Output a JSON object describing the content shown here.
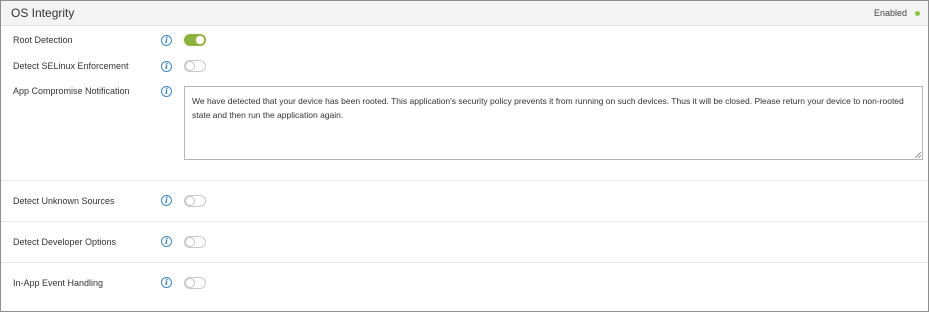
{
  "panel": {
    "title": "OS Integrity",
    "status": "Enabled",
    "status_color": "#8cc63f"
  },
  "settings": [
    {
      "label": "Root Detection",
      "enabled": true
    },
    {
      "label": "Detect SELinux Enforcement",
      "enabled": false
    },
    {
      "label": "App Compromise Notification"
    },
    {
      "label": "Detect Unknown Sources",
      "enabled": false
    },
    {
      "label": "Detect Developer Options",
      "enabled": false
    },
    {
      "label": "In-App Event Handling",
      "enabled": false
    }
  ],
  "notification_message": "We have detected that your device has been rooted. This application's security policy prevents it from running on such devices. Thus it will be closed. Please return your device to non-rooted state and then run the application again.",
  "info_icon_glyph": "i",
  "colors": {
    "toggle_on": "#8cb33b",
    "info_icon": "#3a89c9"
  }
}
